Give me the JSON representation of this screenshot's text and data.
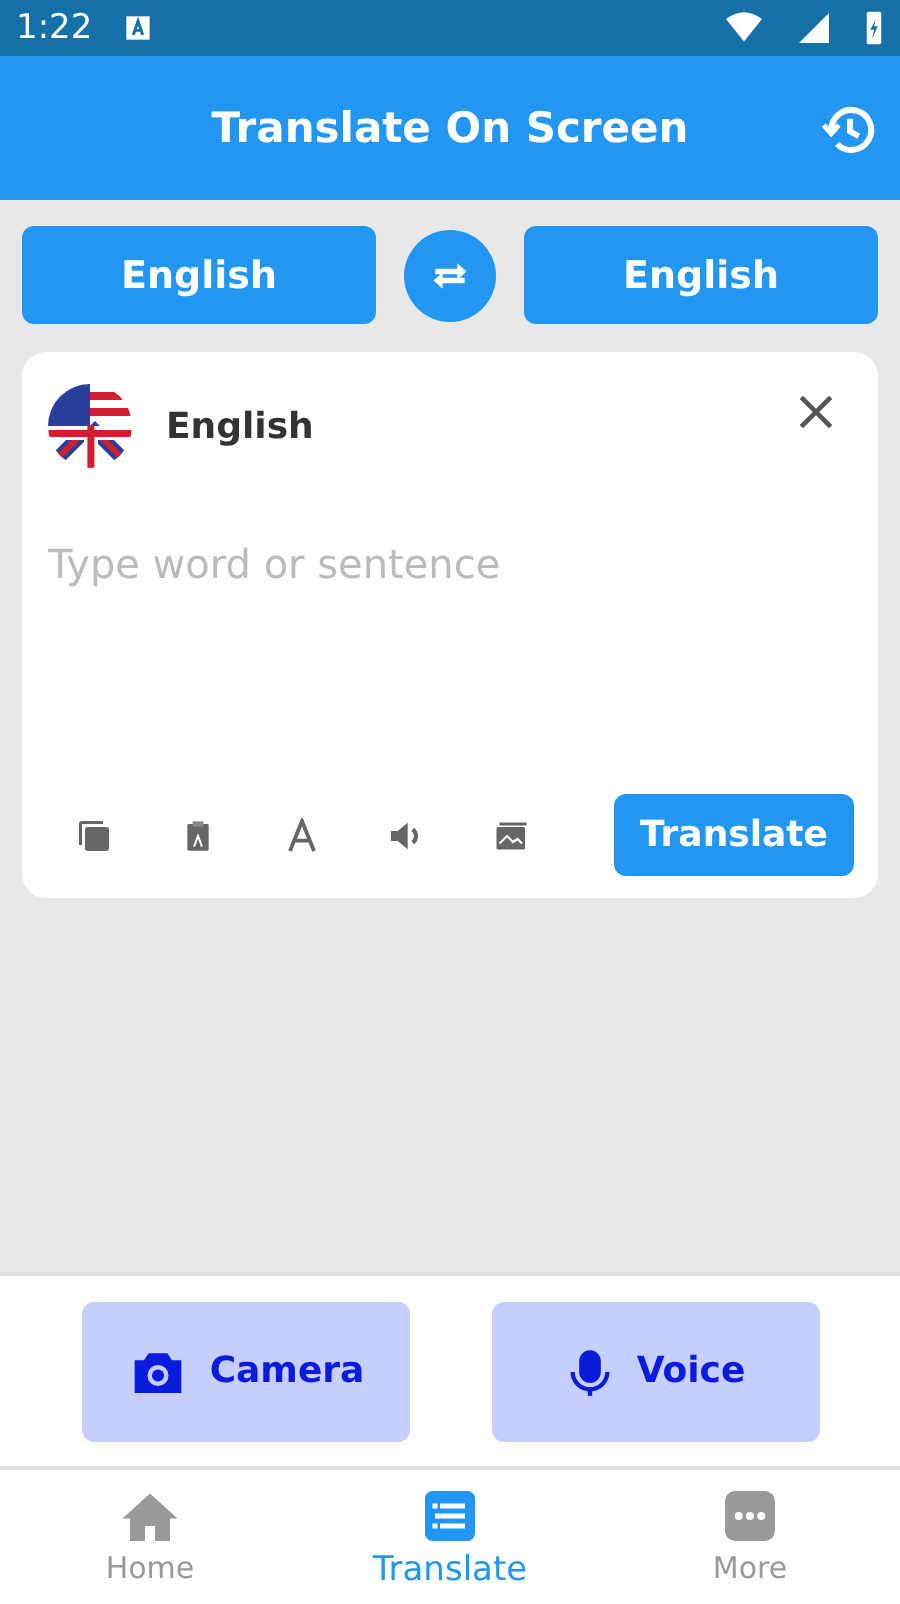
{
  "status_bar": {
    "time": "1:22"
  },
  "app_bar": {
    "title": "Translate On Screen"
  },
  "languages": {
    "source": "English",
    "target": "English"
  },
  "input_card": {
    "language": "English",
    "placeholder": "Type word or sentence",
    "translate_button": "Translate"
  },
  "actions": [
    {
      "kind": "camera",
      "label": "Camera"
    },
    {
      "kind": "voice",
      "label": "Voice"
    }
  ],
  "bottom_nav": [
    {
      "kind": "home",
      "label": "Home",
      "selected": false
    },
    {
      "kind": "translate",
      "label": "Translate",
      "selected": true
    },
    {
      "kind": "more",
      "label": "More",
      "selected": false
    }
  ]
}
